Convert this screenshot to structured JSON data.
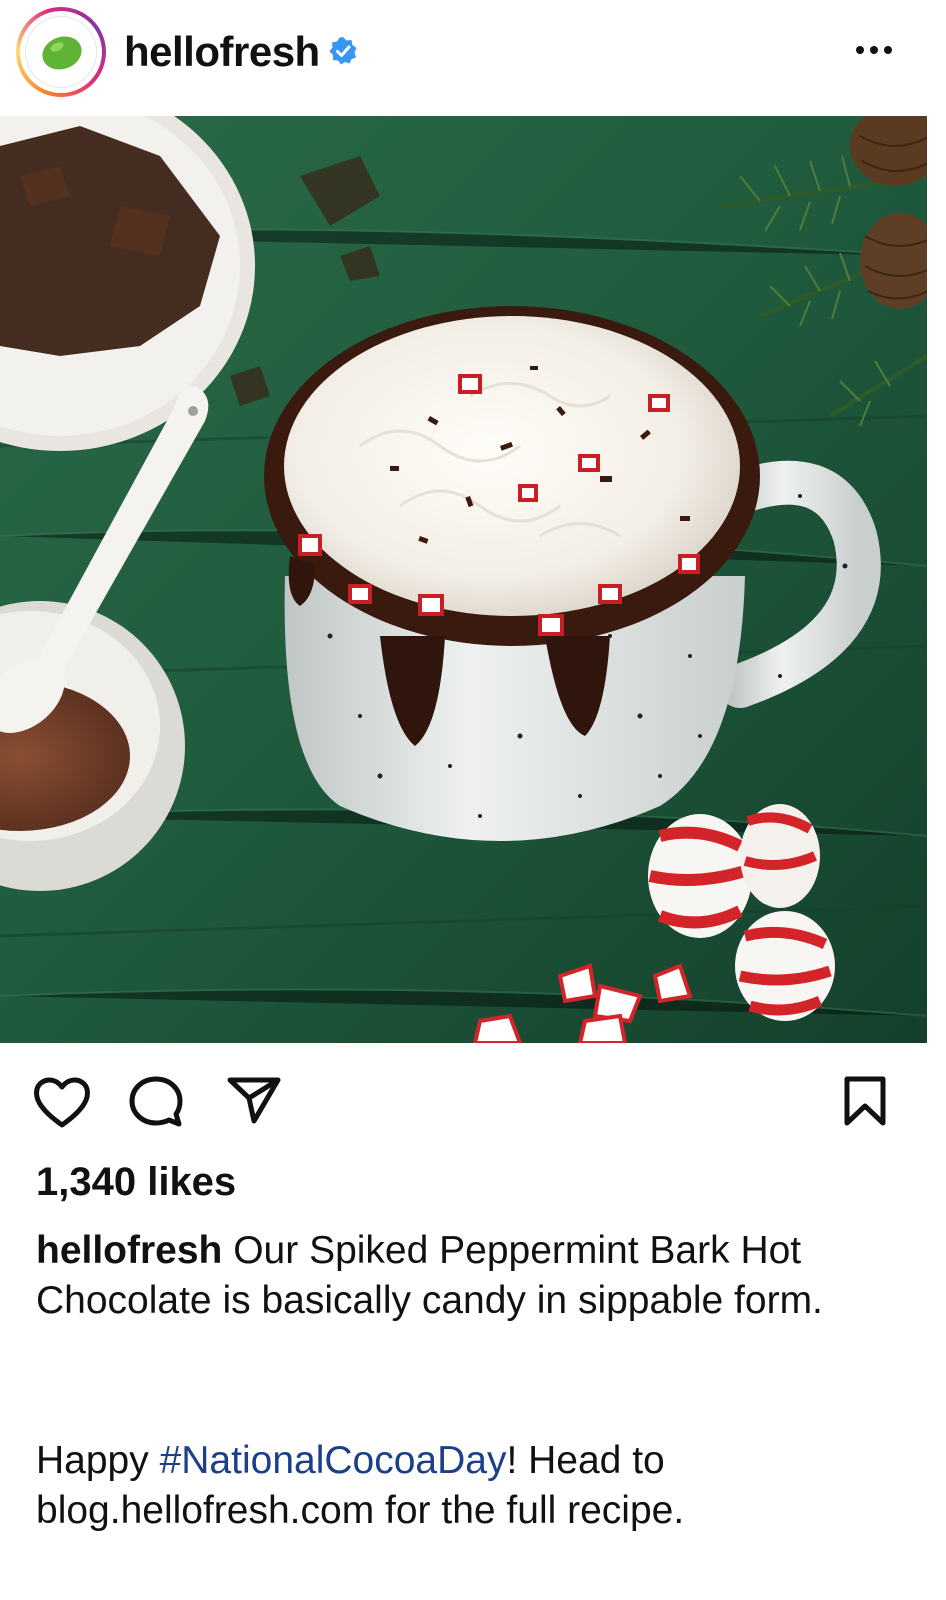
{
  "header": {
    "username": "hellofresh",
    "verified": true,
    "icons": {
      "avatar": "lime-logo-icon",
      "verified": "verified-badge-icon",
      "more": "more-options-icon"
    }
  },
  "post": {
    "image_alt_icon": "hot-chocolate-photo",
    "actions": {
      "like_icon": "heart-icon",
      "comment_icon": "comment-icon",
      "share_icon": "send-icon",
      "save_icon": "bookmark-icon"
    },
    "likes": "1,340 likes",
    "caption": {
      "username": "hellofresh",
      "text": "Our Spiked Peppermint Bark Hot Chocolate is basically candy in sippable form.",
      "line2_prefix": "Happy ",
      "hashtag": "#NationalCocoaDay",
      "line2_suffix": "! Head to blog.hellofresh.com for the full recipe."
    }
  },
  "colors": {
    "verified_blue": "#3897f0",
    "hashtag": "#1c3f8a",
    "lime_green": "#5fb336",
    "table_green": "#1f5a3c"
  }
}
